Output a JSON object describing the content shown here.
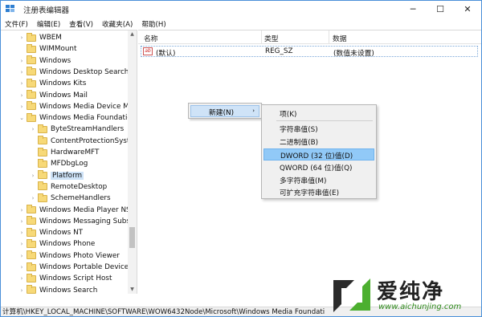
{
  "window": {
    "title": "注册表编辑器",
    "minimize": "─",
    "maximize": "☐",
    "close": "✕"
  },
  "menu": [
    "文件(F)",
    "编辑(E)",
    "查看(V)",
    "收藏夹(A)",
    "帮助(H)"
  ],
  "tree": [
    {
      "label": "WBEM",
      "level": 0,
      "expander": "›"
    },
    {
      "label": "WIMMount",
      "level": 0,
      "expander": ""
    },
    {
      "label": "Windows",
      "level": 0,
      "expander": "›"
    },
    {
      "label": "Windows Desktop Search",
      "level": 0,
      "expander": "›"
    },
    {
      "label": "Windows Kits",
      "level": 0,
      "expander": "›"
    },
    {
      "label": "Windows Mail",
      "level": 0,
      "expander": "›"
    },
    {
      "label": "Windows Media Device M",
      "level": 0,
      "expander": "›"
    },
    {
      "label": "Windows Media Foundatic",
      "level": 0,
      "expander": "⌄"
    },
    {
      "label": "ByteStreamHandlers",
      "level": 1,
      "expander": "›"
    },
    {
      "label": "ContentProtectionSyste",
      "level": 1,
      "expander": ""
    },
    {
      "label": "HardwareMFT",
      "level": 1,
      "expander": ""
    },
    {
      "label": "MFDbgLog",
      "level": 1,
      "expander": ""
    },
    {
      "label": "Platform",
      "level": 1,
      "expander": "›",
      "selected": true
    },
    {
      "label": "RemoteDesktop",
      "level": 1,
      "expander": ""
    },
    {
      "label": "SchemeHandlers",
      "level": 1,
      "expander": "›"
    },
    {
      "label": "Windows Media Player NS",
      "level": 0,
      "expander": "›"
    },
    {
      "label": "Windows Messaging Subs",
      "level": 0,
      "expander": "›"
    },
    {
      "label": "Windows NT",
      "level": 0,
      "expander": "›"
    },
    {
      "label": "Windows Phone",
      "level": 0,
      "expander": "›"
    },
    {
      "label": "Windows Photo Viewer",
      "level": 0,
      "expander": "›"
    },
    {
      "label": "Windows Portable Devices",
      "level": 0,
      "expander": "›"
    },
    {
      "label": "Windows Script Host",
      "level": 0,
      "expander": "›"
    },
    {
      "label": "Windows Search",
      "level": 0,
      "expander": "›"
    }
  ],
  "values": {
    "headers": {
      "name": "名称",
      "type": "类型",
      "data": "数据"
    },
    "rows": [
      {
        "icon": "ab",
        "name": "(默认)",
        "type": "REG_SZ",
        "data": "(数值未设置)"
      }
    ]
  },
  "context_menu": {
    "item": "新建(N)",
    "arrow": "›"
  },
  "submenu": [
    "项(K)",
    "字符串值(S)",
    "二进制值(B)",
    "DWORD (32 位)值(D)",
    "QWORD (64 位)值(Q)",
    "多字符串值(M)",
    "可扩充字符串值(E)"
  ],
  "submenu_highlight": "DWORD (32 位)值(D)",
  "status": "计算机\\HKEY_LOCAL_MACHINE\\SOFTWARE\\WOW6432Node\\Microsoft\\Windows Media Foundati",
  "watermark": {
    "brand": "爱纯净",
    "url": "www.aichunjing.com"
  },
  "colors": {
    "accent": "#4a90d9",
    "highlight": "#91c9f7",
    "folder": "#f7d978"
  }
}
